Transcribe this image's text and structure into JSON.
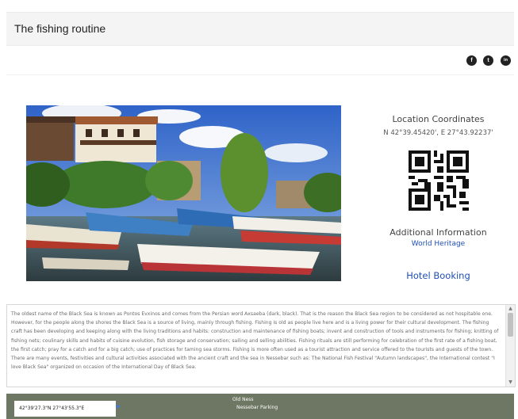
{
  "header": {
    "title": "The fishing routine"
  },
  "share": {
    "facebook_icon": "f",
    "twitter_icon": "t",
    "linkedin_icon": "in"
  },
  "side": {
    "location_title": "Location Coordinates",
    "coordinates": "N 42°39.45420', E 27°43.92237'",
    "additional_title": "Additional Information",
    "world_heritage_link": "World Heritage",
    "hotel_booking_link": "Hotel Booking"
  },
  "description": "The oldest name of the Black Sea is known as Pontos Evxinos and comes from the Persian word Axsaeba (dark, black). That is the reason the Black Sea region to be considered as not hospitable one. However, for the people along the shores the Black Sea is a source of living, mainly through fishing. Fishing is old as people live here and is a living power for their cultural development. The fishing craft has been developing and keeping along with the living traditions and habits: construction and maintenance of fishing boats; invent and construction of tools and instruments for fishing; knitting of fishing nets; coulinary skills and habits of cuisine evolution, fish storage and conservation; sailing and selling abilities. Fishing rituals are still performing for celebration of the first rate of a fishing boat, the first catch; pray for a catch and for a big catch; use of practices for taming sea storms. Fishing is more often used as a tourist attraction and service offered to the tourists and guests of the town. There are many events, festivities and cultural activities associated with the ancient craft and the sea in Nessebar such as: The National Fish Festival \"Autumn landscapes\", the International contest \"I love Black Sea\" organized on occasion of the International Day of Black Sea.",
  "map": {
    "coords": "42°39'27.3\"N 27°43'55.3\"E",
    "label_1": "Old Ness",
    "label_2": "Nessebar Parking"
  },
  "colors": {
    "link": "#1f4fb5",
    "header_bg": "#f4f4f4"
  }
}
